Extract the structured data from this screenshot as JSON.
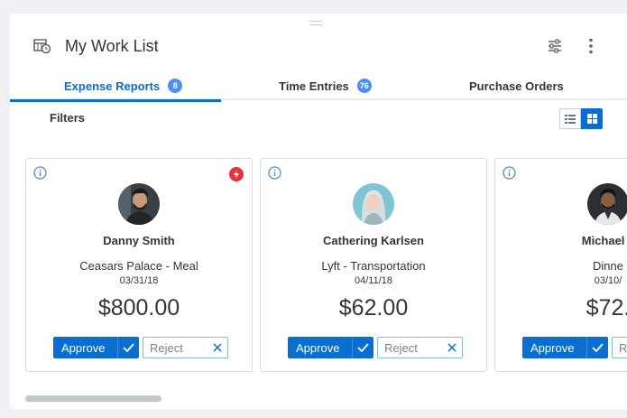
{
  "header": {
    "title": "My Work List",
    "icons": [
      "calendar-clock-icon",
      "settings-sliders-icon",
      "more-vertical-icon"
    ]
  },
  "tabs": [
    {
      "label": "Expense Reports",
      "count": "8",
      "active": true
    },
    {
      "label": "Time Entries",
      "count": "76",
      "active": false
    },
    {
      "label": "Purchase Orders",
      "count": "",
      "active": false
    }
  ],
  "toolbar": {
    "filters_label": "Filters",
    "view_modes": [
      "list-view-icon",
      "grid-view-icon"
    ],
    "active_view": "grid"
  },
  "cards": [
    {
      "name": "Danny Smith",
      "description": "Ceasars Palace - Meal",
      "date": "03/31/18",
      "amount": "$800.00",
      "urgent": true,
      "approve_label": "Approve",
      "reject_label": "Reject"
    },
    {
      "name": "Cathering Karlsen",
      "description": "Lyft - Transportation",
      "date": "04/11/18",
      "amount": "$62.00",
      "urgent": false,
      "approve_label": "Approve",
      "reject_label": "Reject"
    },
    {
      "name": "Michael J",
      "description": "Dinne",
      "date": "03/10/",
      "amount": "$72.",
      "urgent": false,
      "approve_label": "Approve",
      "reject_label": "Reject"
    }
  ],
  "colors": {
    "accent": "#0a6ed1",
    "badge": "#4d8ff0",
    "urgent": "#e8303d",
    "background": "#eef0f4"
  }
}
